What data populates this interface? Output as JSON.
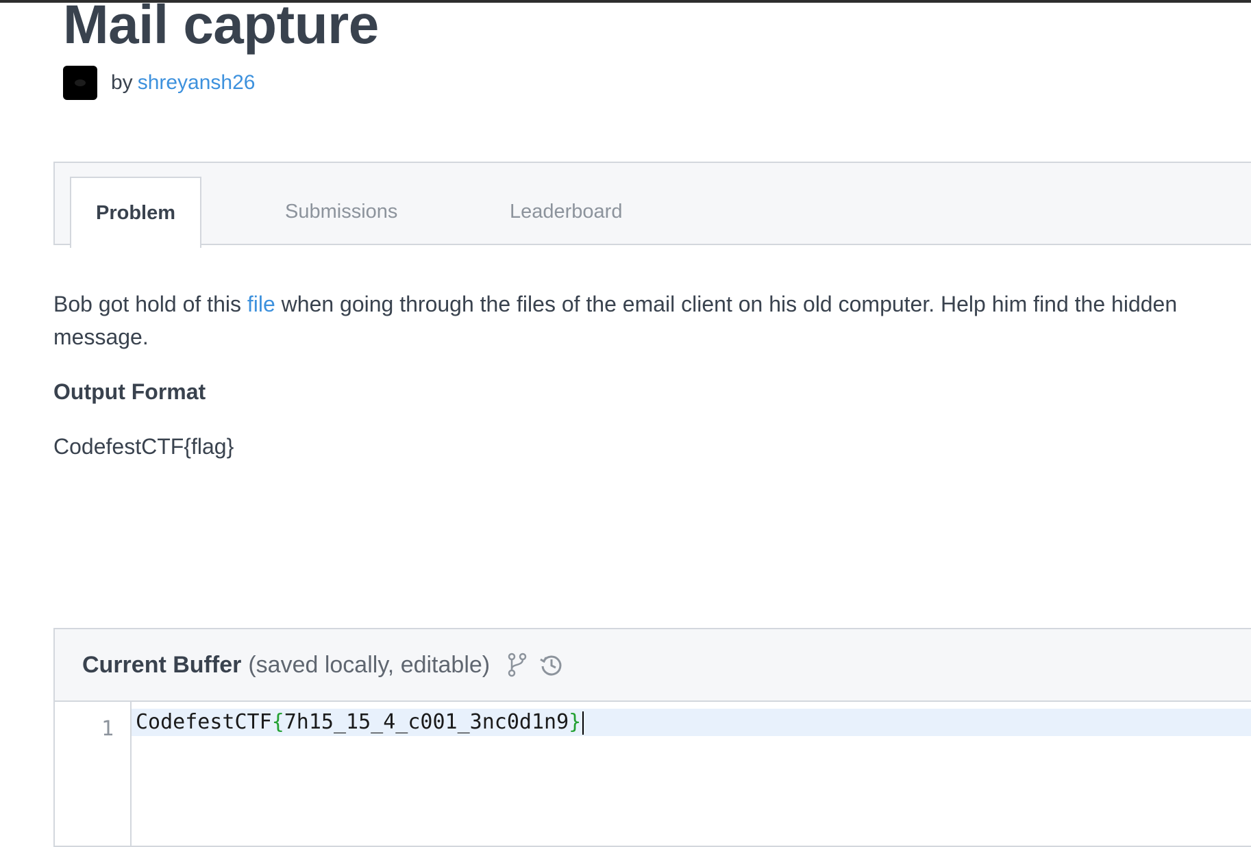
{
  "page": {
    "title": "Mail capture",
    "author_prefix": "by",
    "author": "shreyansh26"
  },
  "tabs": [
    {
      "label": "Problem",
      "active": true
    },
    {
      "label": "Submissions",
      "active": false
    },
    {
      "label": "Leaderboard",
      "active": false
    }
  ],
  "problem": {
    "desc_before": "Bob got hold of this ",
    "desc_link": "file",
    "desc_after": " when going through the files of the email client on his old computer. Help him find the hidden message.",
    "output_heading": "Output Format",
    "output_format": "CodefestCTF{flag}"
  },
  "editor": {
    "title": "Current Buffer",
    "subtitle": "(saved locally, editable)",
    "icons": [
      "branch-icon",
      "history-icon"
    ],
    "line_number": "1",
    "code_prefix": "CodefestCTF",
    "code_open": "{",
    "code_body": "7h15_15_4_c001_3nc0d1n9",
    "code_close": "}"
  },
  "colors": {
    "link": "#3d91dd",
    "text": "#39424e",
    "brace": "#22a032",
    "active_line": "#e8f1fc"
  }
}
